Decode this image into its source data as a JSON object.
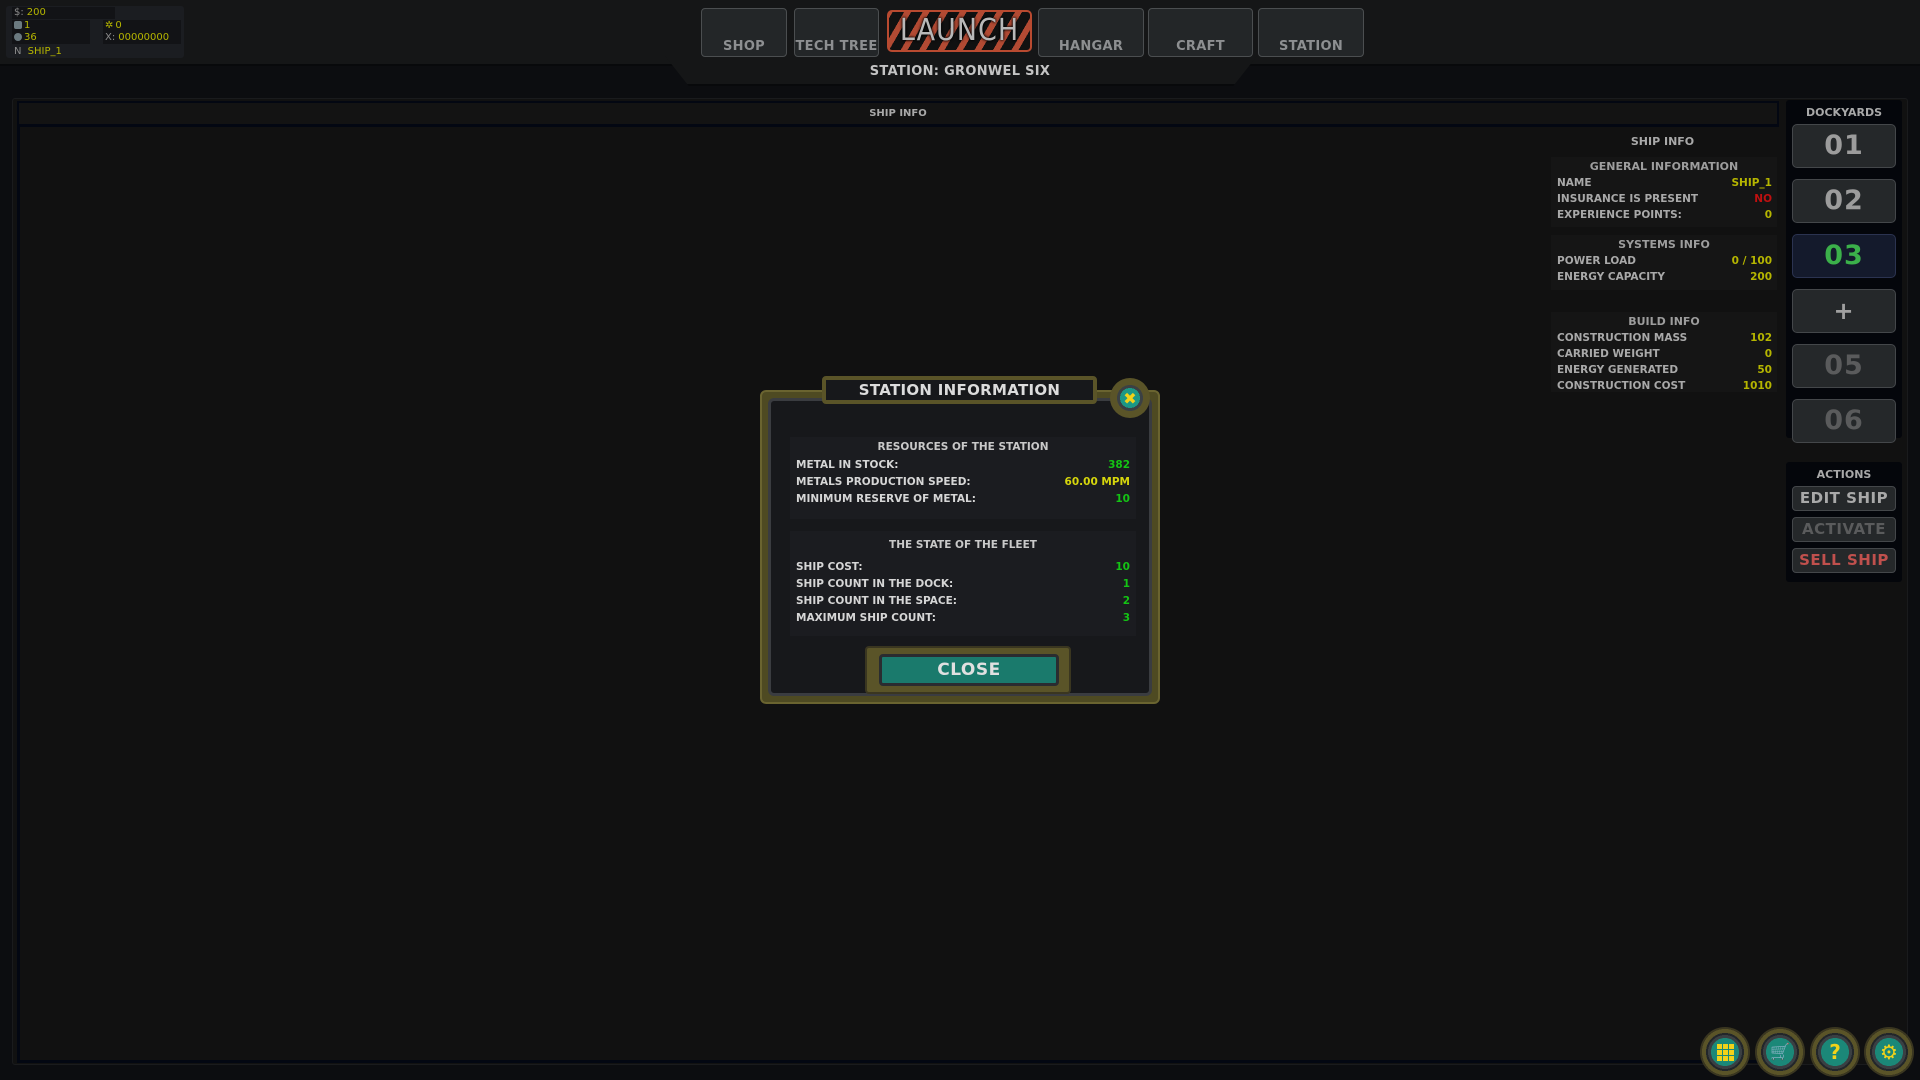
{
  "stats": {
    "money_label": "$:",
    "money": "200",
    "resource_a": "1",
    "resource_b": "36",
    "gears": "0",
    "x_label": "X:",
    "x_value": "00000000",
    "name_label": "N",
    "ship_name": "SHIP_1"
  },
  "nav": {
    "shop": "SHOP",
    "tech_tree": "TECH TREE",
    "launch": "LAUNCH",
    "hangar": "HANGAR",
    "craft": "CRAFT",
    "station": "STATION"
  },
  "station_name": "STATION: GRONWEL SIX",
  "ship_info_bar": "SHIP INFO",
  "info_panel": {
    "title": "SHIP INFO",
    "general": {
      "title": "GENERAL INFORMATION",
      "rows": [
        {
          "label": "NAME",
          "value": "SHIP_1"
        },
        {
          "label": "INSURANCE IS PRESENT",
          "value": "NO"
        },
        {
          "label": "EXPERIENCE POINTS:",
          "value": "0"
        }
      ]
    },
    "systems": {
      "title": "SYSTEMS INFO",
      "rows": [
        {
          "label": "POWER LOAD",
          "value": "0 / 100"
        },
        {
          "label": "ENERGY CAPACITY",
          "value": "200"
        }
      ]
    },
    "build": {
      "title": "BUILD INFO",
      "rows": [
        {
          "label": "CONSTRUCTION MASS",
          "value": "102"
        },
        {
          "label": "CARRIED WEIGHT",
          "value": "0"
        },
        {
          "label": "ENERGY GENERATED",
          "value": "50"
        },
        {
          "label": "CONSTRUCTION COST",
          "value": "1010"
        }
      ]
    }
  },
  "dockyards": {
    "title": "DOCKYARDS",
    "slots": [
      {
        "label": "01",
        "state": "normal"
      },
      {
        "label": "02",
        "state": "normal"
      },
      {
        "label": "03",
        "state": "active"
      },
      {
        "label": "+",
        "state": "add"
      },
      {
        "label": "05",
        "state": "disabled"
      },
      {
        "label": "06",
        "state": "disabled"
      }
    ]
  },
  "actions": {
    "title": "ACTIONS",
    "edit": "EDIT SHIP",
    "activate": "ACTIVATE",
    "sell": "SELL SHIP"
  },
  "bottom_buttons": [
    {
      "icon": "grid-icon",
      "glyph": ""
    },
    {
      "icon": "cart-icon",
      "glyph": "🛒"
    },
    {
      "icon": "help-icon",
      "glyph": "?"
    },
    {
      "icon": "gear-icon",
      "glyph": "⚙"
    }
  ],
  "modal": {
    "title": "STATION INFORMATION",
    "close_glyph": "✖",
    "resources": {
      "title": "RESOURCES OF THE STATION",
      "rows": [
        {
          "label": "METAL IN STOCK:",
          "value": "382"
        },
        {
          "label": "METALS PRODUCTION SPEED:",
          "value": "60.00 MPM"
        },
        {
          "label": "MINIMUM RESERVE OF METAL:",
          "value": "10"
        }
      ]
    },
    "fleet": {
      "title": "THE STATE OF THE FLEET",
      "rows": [
        {
          "label": "SHIP COST:",
          "value": "10"
        },
        {
          "label": "SHIP COUNT IN THE DOCK:",
          "value": "1"
        },
        {
          "label": "SHIP COUNT IN THE SPACE:",
          "value": "2"
        },
        {
          "label": "MAXIMUM SHIP COUNT:",
          "value": "3"
        }
      ]
    },
    "close_label": "CLOSE"
  }
}
